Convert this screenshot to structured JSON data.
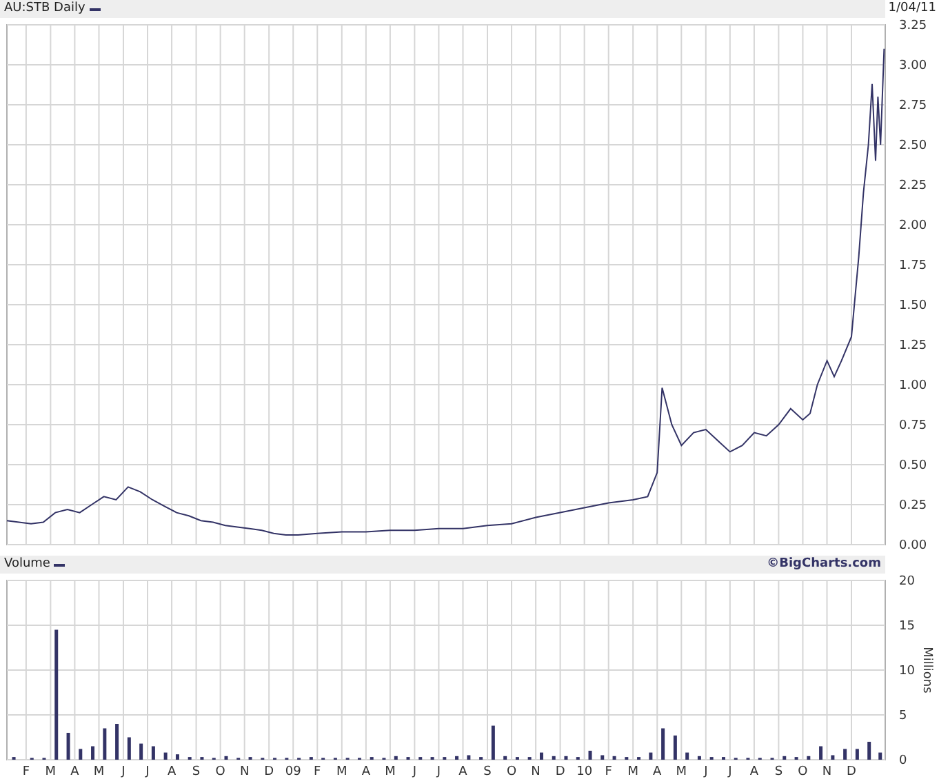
{
  "price_panel": {
    "date": "1/04/11",
    "chart_data": {
      "type": "line",
      "title": "AU:STB Daily",
      "grid": true,
      "xlim": [
        8.017,
        11.033
      ],
      "ylim": [
        0,
        3.25
      ],
      "x": [
        8.017,
        8.058,
        8.1,
        8.142,
        8.183,
        8.225,
        8.267,
        8.308,
        8.35,
        8.392,
        8.433,
        8.475,
        8.517,
        8.558,
        8.6,
        8.642,
        8.683,
        8.725,
        8.767,
        8.808,
        8.85,
        8.892,
        8.933,
        8.975,
        9.017,
        9.083,
        9.167,
        9.25,
        9.333,
        9.417,
        9.5,
        9.583,
        9.667,
        9.75,
        9.833,
        9.917,
        10,
        10.083,
        10.167,
        10.217,
        10.25,
        10.267,
        10.3,
        10.333,
        10.375,
        10.417,
        10.458,
        10.5,
        10.542,
        10.583,
        10.625,
        10.667,
        10.708,
        10.75,
        10.775,
        10.8,
        10.833,
        10.858,
        10.883,
        10.917,
        10.942,
        10.958,
        10.975,
        10.988,
        11,
        11.008,
        11.017,
        11.029
      ],
      "series": [
        {
          "color": "#333366",
          "values": [
            0.15,
            0.14,
            0.13,
            0.14,
            0.2,
            0.22,
            0.2,
            0.25,
            0.3,
            0.28,
            0.36,
            0.33,
            0.28,
            0.24,
            0.2,
            0.18,
            0.15,
            0.14,
            0.12,
            0.11,
            0.1,
            0.09,
            0.07,
            0.06,
            0.06,
            0.07,
            0.08,
            0.08,
            0.09,
            0.09,
            0.1,
            0.1,
            0.12,
            0.13,
            0.17,
            0.2,
            0.23,
            0.26,
            0.28,
            0.3,
            0.45,
            0.98,
            0.75,
            0.62,
            0.7,
            0.72,
            0.65,
            0.58,
            0.62,
            0.7,
            0.68,
            0.75,
            0.85,
            0.78,
            0.82,
            1.0,
            1.15,
            1.05,
            1.15,
            1.3,
            1.8,
            2.2,
            2.5,
            2.88,
            2.4,
            2.8,
            2.5,
            3.1
          ]
        }
      ],
      "yticks": [
        {
          "value": 0,
          "label": "0.00"
        },
        {
          "value": 0.25,
          "label": "0.25"
        },
        {
          "value": 0.5,
          "label": "0.50"
        },
        {
          "value": 0.75,
          "label": "0.75"
        },
        {
          "value": 1,
          "label": "1.00"
        },
        {
          "value": 1.25,
          "label": "1.25"
        },
        {
          "value": 1.5,
          "label": "1.50"
        },
        {
          "value": 1.75,
          "label": "1.75"
        },
        {
          "value": 2,
          "label": "2.00"
        },
        {
          "value": 2.25,
          "label": "2.25"
        },
        {
          "value": 2.5,
          "label": "2.50"
        },
        {
          "value": 2.75,
          "label": "2.75"
        },
        {
          "value": 3,
          "label": "3.00"
        },
        {
          "value": 3.25,
          "label": "3.25"
        }
      ]
    }
  },
  "volume_panel": {
    "credit": "©BigCharts.com",
    "chart_data": {
      "type": "bar",
      "title": "Volume",
      "ylabel": "Millions",
      "grid": true,
      "xlim": [
        8.017,
        11.033
      ],
      "ylim": [
        0,
        20
      ],
      "x": [
        8.042,
        8.104,
        8.146,
        8.188,
        8.229,
        8.271,
        8.313,
        8.354,
        8.396,
        8.438,
        8.479,
        8.521,
        8.563,
        8.604,
        8.646,
        8.688,
        8.729,
        8.771,
        8.813,
        8.854,
        8.896,
        8.938,
        8.979,
        9.021,
        9.063,
        9.104,
        9.146,
        9.188,
        9.229,
        9.271,
        9.313,
        9.354,
        9.396,
        9.438,
        9.479,
        9.521,
        9.563,
        9.604,
        9.646,
        9.688,
        9.729,
        9.771,
        9.813,
        9.854,
        9.896,
        9.938,
        9.979,
        10.021,
        10.063,
        10.104,
        10.146,
        10.188,
        10.229,
        10.271,
        10.313,
        10.354,
        10.396,
        10.438,
        10.479,
        10.521,
        10.563,
        10.604,
        10.646,
        10.688,
        10.729,
        10.771,
        10.813,
        10.854,
        10.896,
        10.938,
        10.979,
        11.017
      ],
      "series": [
        {
          "color": "#333366",
          "values": [
            0.3,
            0.2,
            0.2,
            14.5,
            3,
            1.2,
            1.5,
            3.5,
            4,
            2.5,
            1.8,
            1.5,
            0.8,
            0.6,
            0.3,
            0.3,
            0.2,
            0.4,
            0.2,
            0.3,
            0.2,
            0.2,
            0.2,
            0.2,
            0.3,
            0.2,
            0.2,
            0.2,
            0.2,
            0.3,
            0.2,
            0.4,
            0.3,
            0.3,
            0.3,
            0.3,
            0.4,
            0.5,
            0.3,
            3.8,
            0.4,
            0.3,
            0.3,
            0.8,
            0.4,
            0.4,
            0.3,
            1,
            0.5,
            0.4,
            0.3,
            0.3,
            0.8,
            3.5,
            2.7,
            0.8,
            0.4,
            0.3,
            0.3,
            0.2,
            0.2,
            0.2,
            0.2,
            0.4,
            0.3,
            0.4,
            1.5,
            0.5,
            1.2,
            1.2,
            2,
            0.8
          ]
        }
      ],
      "xticks": [
        {
          "value": 8.083,
          "label": "F"
        },
        {
          "value": 8.167,
          "label": "M"
        },
        {
          "value": 8.25,
          "label": "A"
        },
        {
          "value": 8.333,
          "label": "M"
        },
        {
          "value": 8.417,
          "label": "J"
        },
        {
          "value": 8.5,
          "label": "J"
        },
        {
          "value": 8.583,
          "label": "A"
        },
        {
          "value": 8.667,
          "label": "S"
        },
        {
          "value": 8.75,
          "label": "O"
        },
        {
          "value": 8.833,
          "label": "N"
        },
        {
          "value": 8.917,
          "label": "D"
        },
        {
          "value": 9,
          "label": "09"
        },
        {
          "value": 9.083,
          "label": "F"
        },
        {
          "value": 9.167,
          "label": "M"
        },
        {
          "value": 9.25,
          "label": "A"
        },
        {
          "value": 9.333,
          "label": "M"
        },
        {
          "value": 9.417,
          "label": "J"
        },
        {
          "value": 9.5,
          "label": "J"
        },
        {
          "value": 9.583,
          "label": "A"
        },
        {
          "value": 9.667,
          "label": "S"
        },
        {
          "value": 9.75,
          "label": "O"
        },
        {
          "value": 9.833,
          "label": "N"
        },
        {
          "value": 9.917,
          "label": "D"
        },
        {
          "value": 10,
          "label": "10"
        },
        {
          "value": 10.083,
          "label": "F"
        },
        {
          "value": 10.167,
          "label": "M"
        },
        {
          "value": 10.25,
          "label": "A"
        },
        {
          "value": 10.333,
          "label": "M"
        },
        {
          "value": 10.417,
          "label": "J"
        },
        {
          "value": 10.5,
          "label": "J"
        },
        {
          "value": 10.583,
          "label": "A"
        },
        {
          "value": 10.667,
          "label": "S"
        },
        {
          "value": 10.75,
          "label": "O"
        },
        {
          "value": 10.833,
          "label": "N"
        },
        {
          "value": 10.917,
          "label": "D"
        }
      ],
      "yticks": [
        0,
        5,
        10,
        15,
        20
      ]
    }
  }
}
